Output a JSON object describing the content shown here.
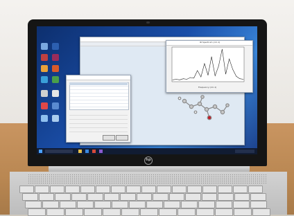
{
  "screen": {
    "brand_logo": "hp",
    "spectrum_window": {
      "title": "IR Spectrum (cm-1)",
      "xlabel": "Frequency (cm-1)"
    }
  },
  "colors": {
    "desktop_blue": "#1a4ea8",
    "bezel": "#151515",
    "desk_wood": "#b98752",
    "spectrum_line": "#222222"
  },
  "chart_data": {
    "type": "line",
    "note_values_estimated": true,
    "x": [
      0,
      10,
      20,
      30,
      40,
      50,
      60,
      70,
      80,
      90,
      100,
      110,
      120,
      130,
      140,
      150,
      160,
      170,
      180,
      190,
      200
    ],
    "values": [
      2,
      3,
      2,
      4,
      3,
      6,
      5,
      18,
      7,
      30,
      10,
      42,
      9,
      26,
      55,
      12,
      38,
      20,
      8,
      4,
      3
    ]
  }
}
